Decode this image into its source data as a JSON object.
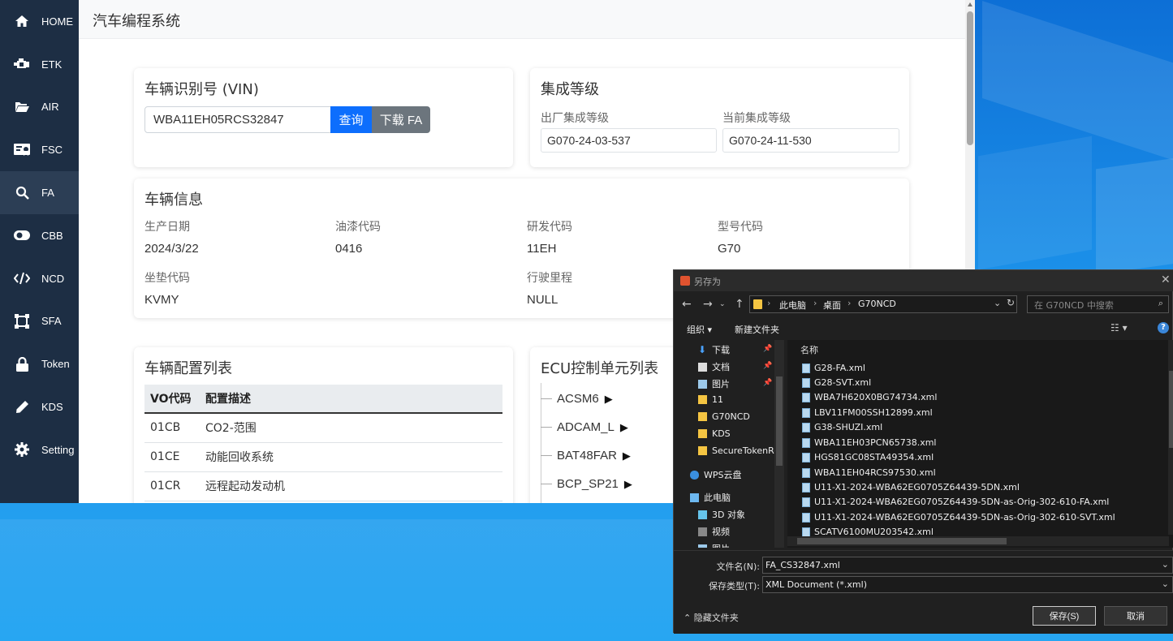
{
  "app": {
    "title": "汽车编程系统",
    "sidebar": [
      {
        "label": "HOME",
        "icon": "home-icon"
      },
      {
        "label": "ETK",
        "icon": "engine-icon"
      },
      {
        "label": "AIR",
        "icon": "folder-open-icon"
      },
      {
        "label": "FSC",
        "icon": "certificate-icon"
      },
      {
        "label": "FA",
        "icon": "search-icon",
        "active": true
      },
      {
        "label": "CBB",
        "icon": "toggle-icon"
      },
      {
        "label": "NCD",
        "icon": "code-icon"
      },
      {
        "label": "SFA",
        "icon": "vector-square-icon"
      },
      {
        "label": "Token",
        "icon": "lock-icon"
      },
      {
        "label": "KDS",
        "icon": "pencil-icon"
      },
      {
        "label": "Setting",
        "icon": "gear-icon"
      }
    ],
    "vin_card": {
      "title": "车辆识别号 (VIN)",
      "vin_value": "WBA11EH05RCS32847",
      "query_label": "查询",
      "download_label": "下载 FA"
    },
    "ilevel_card": {
      "title": "集成等级",
      "factory_label": "出厂集成等级",
      "factory_value": "G070-24-03-537",
      "current_label": "当前集成等级",
      "current_value": "G070-24-11-530"
    },
    "vehicle_info": {
      "title": "车辆信息",
      "fields": [
        {
          "label": "生产日期",
          "value": "2024/3/22"
        },
        {
          "label": "油漆代码",
          "value": "0416"
        },
        {
          "label": "研发代码",
          "value": "11EH"
        },
        {
          "label": "型号代码",
          "value": "G70"
        },
        {
          "label": "坐垫代码",
          "value": "KVMY"
        },
        {
          "label": "行驶里程",
          "value": "NULL"
        }
      ]
    },
    "config_list": {
      "title": "车辆配置列表",
      "headers": [
        "VO代码",
        "配置描述"
      ],
      "rows": [
        [
          "01CB",
          "CO2-范围"
        ],
        [
          "01CE",
          "动能回收系统"
        ],
        [
          "01CR",
          "远程起动发动机"
        ]
      ]
    },
    "ecu_list": {
      "title": "ECU控制单元列表",
      "items": [
        "ACSM6",
        "ADCAM_L",
        "BAT48FAR",
        "BCP_SP21"
      ]
    }
  },
  "dialog": {
    "title": "另存为",
    "breadcrumbs": [
      "此电脑",
      "桌面",
      "G70NCD"
    ],
    "search_placeholder": "在 G70NCD 中搜索",
    "organize_label": "组织 ▾",
    "new_folder_label": "新建文件夹",
    "nav_items": [
      {
        "label": "下载",
        "pinned": true
      },
      {
        "label": "文档",
        "pinned": true
      },
      {
        "label": "图片",
        "pinned": true
      },
      {
        "label": "11"
      },
      {
        "label": "G70NCD"
      },
      {
        "label": "KDS"
      },
      {
        "label": "SecureTokenRe"
      },
      {
        "label": "WPS云盘"
      },
      {
        "label": "此电脑"
      },
      {
        "label": "3D 对象"
      },
      {
        "label": "视频"
      },
      {
        "label": "图片"
      }
    ],
    "column_header": "名称",
    "files": [
      "G28-FA.xml",
      "G28-SVT.xml",
      "WBA7H620X0BG74734.xml",
      "LBV11FM00SSH12899.xml",
      "G38-SHUZI.xml",
      "WBA11EH03PCN65738.xml",
      "HGS81GC08STA49354.xml",
      "WBA11EH04RCS97530.xml",
      "U11-X1-2024-WBA62EG0705Z64439-5DN.xml",
      "U11-X1-2024-WBA62EG0705Z64439-5DN-as-Orig-302-610-FA.xml",
      "U11-X1-2024-WBA62EG0705Z64439-5DN-as-Orig-302-610-SVT.xml",
      "SCATV6100MU203542.xml"
    ],
    "filename_label": "文件名(N):",
    "filename_value": "FA_CS32847.xml",
    "filetype_label": "保存类型(T):",
    "filetype_value": "XML Document (*.xml)",
    "hide_folders_label": "隐藏文件夹",
    "save_label": "保存(S)",
    "cancel_label": "取消"
  }
}
